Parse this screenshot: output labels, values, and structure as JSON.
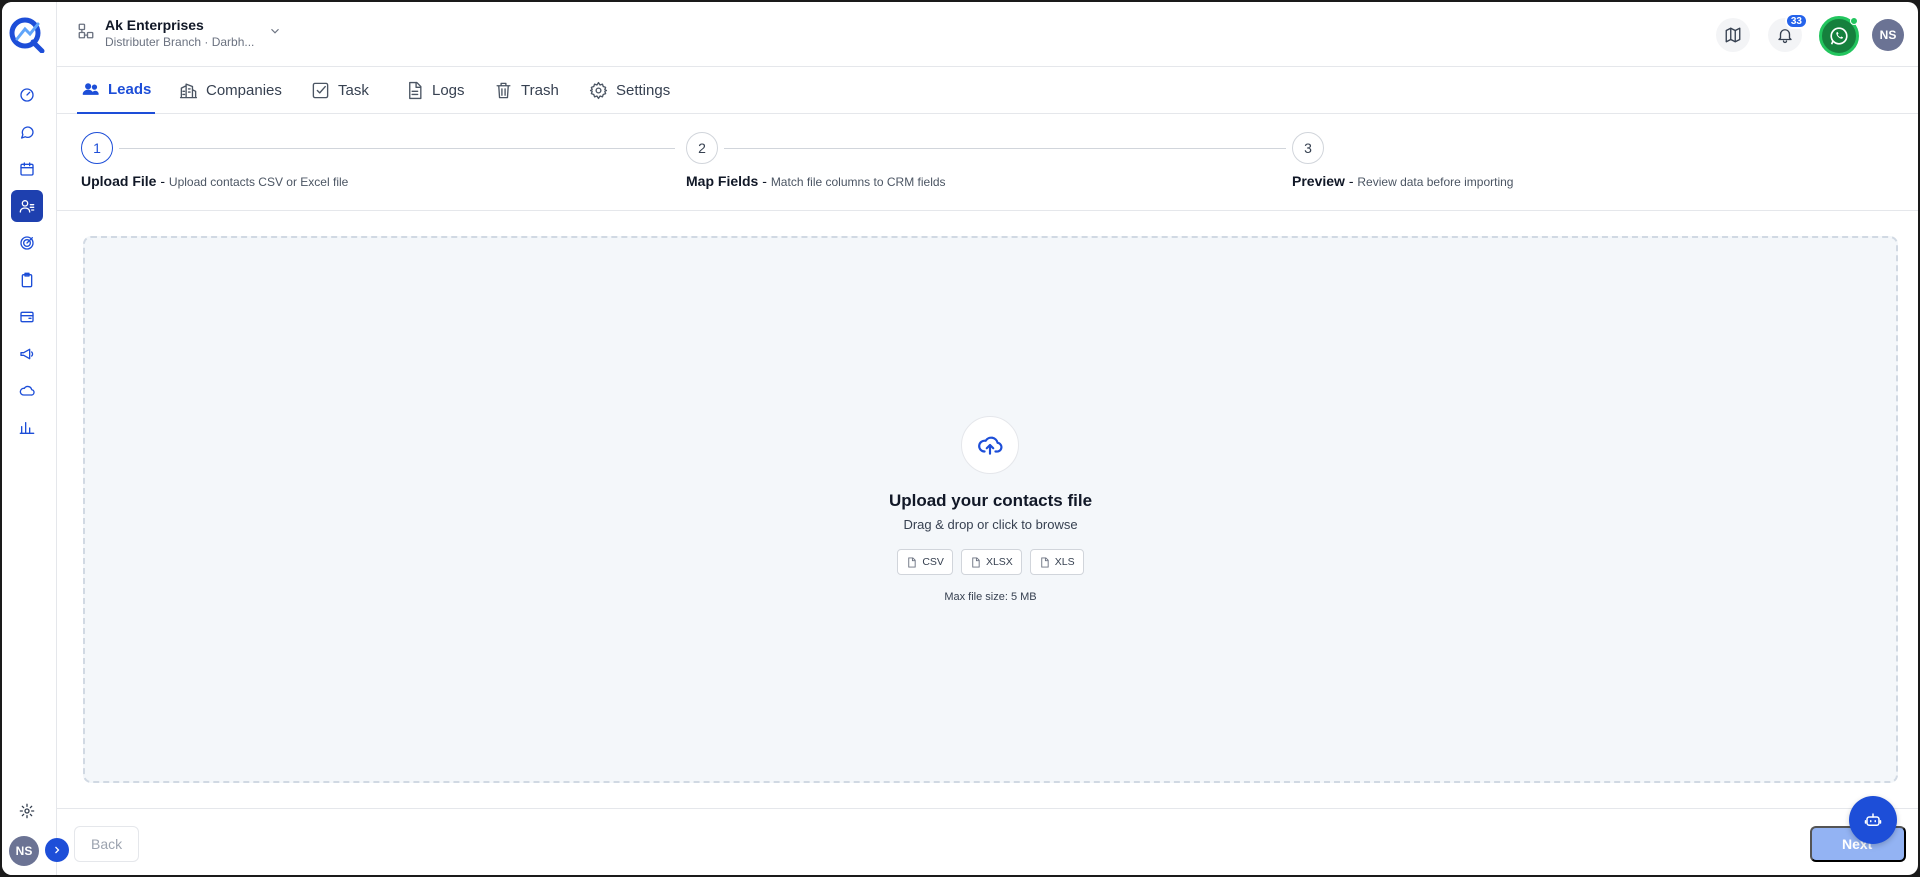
{
  "header": {
    "org_name": "Ak Enterprises",
    "org_sub": "Distributer Branch · Darbh...",
    "notification_count": "33",
    "avatar_initials": "NS"
  },
  "sidebar": {
    "avatar_initials": "NS",
    "items": [
      {
        "name": "dashboard"
      },
      {
        "name": "chat"
      },
      {
        "name": "calendar"
      },
      {
        "name": "contacts",
        "active": true
      },
      {
        "name": "targets"
      },
      {
        "name": "clipboard"
      },
      {
        "name": "billing"
      },
      {
        "name": "campaigns"
      },
      {
        "name": "cloud"
      },
      {
        "name": "reports"
      }
    ]
  },
  "tabs": [
    {
      "label": "Leads",
      "icon": "users-icon",
      "active": true
    },
    {
      "label": "Companies",
      "icon": "building-icon"
    },
    {
      "label": "Task",
      "icon": "check-square-icon"
    },
    {
      "label": "Logs",
      "icon": "file-icon"
    },
    {
      "label": "Trash",
      "icon": "trash-icon"
    },
    {
      "label": "Settings",
      "icon": "gear-icon"
    }
  ],
  "steps": [
    {
      "number": "1",
      "title": "Upload File",
      "sep": " - ",
      "desc": "Upload contacts CSV or Excel file"
    },
    {
      "number": "2",
      "title": "Map Fields",
      "sep": " - ",
      "desc": "Match file columns to CRM fields"
    },
    {
      "number": "3",
      "title": "Preview",
      "sep": " - ",
      "desc": "Review data before importing"
    }
  ],
  "dropzone": {
    "title": "Upload your contacts file",
    "subtitle": "Drag & drop or click to browse",
    "formats": [
      "CSV",
      "XLSX",
      "XLS"
    ],
    "max_size": "Max file size: 5 MB"
  },
  "footer": {
    "back_label": "Back",
    "next_label": "Next"
  },
  "colors": {
    "accent": "#1d4ed8",
    "whatsapp": "#15803d"
  }
}
